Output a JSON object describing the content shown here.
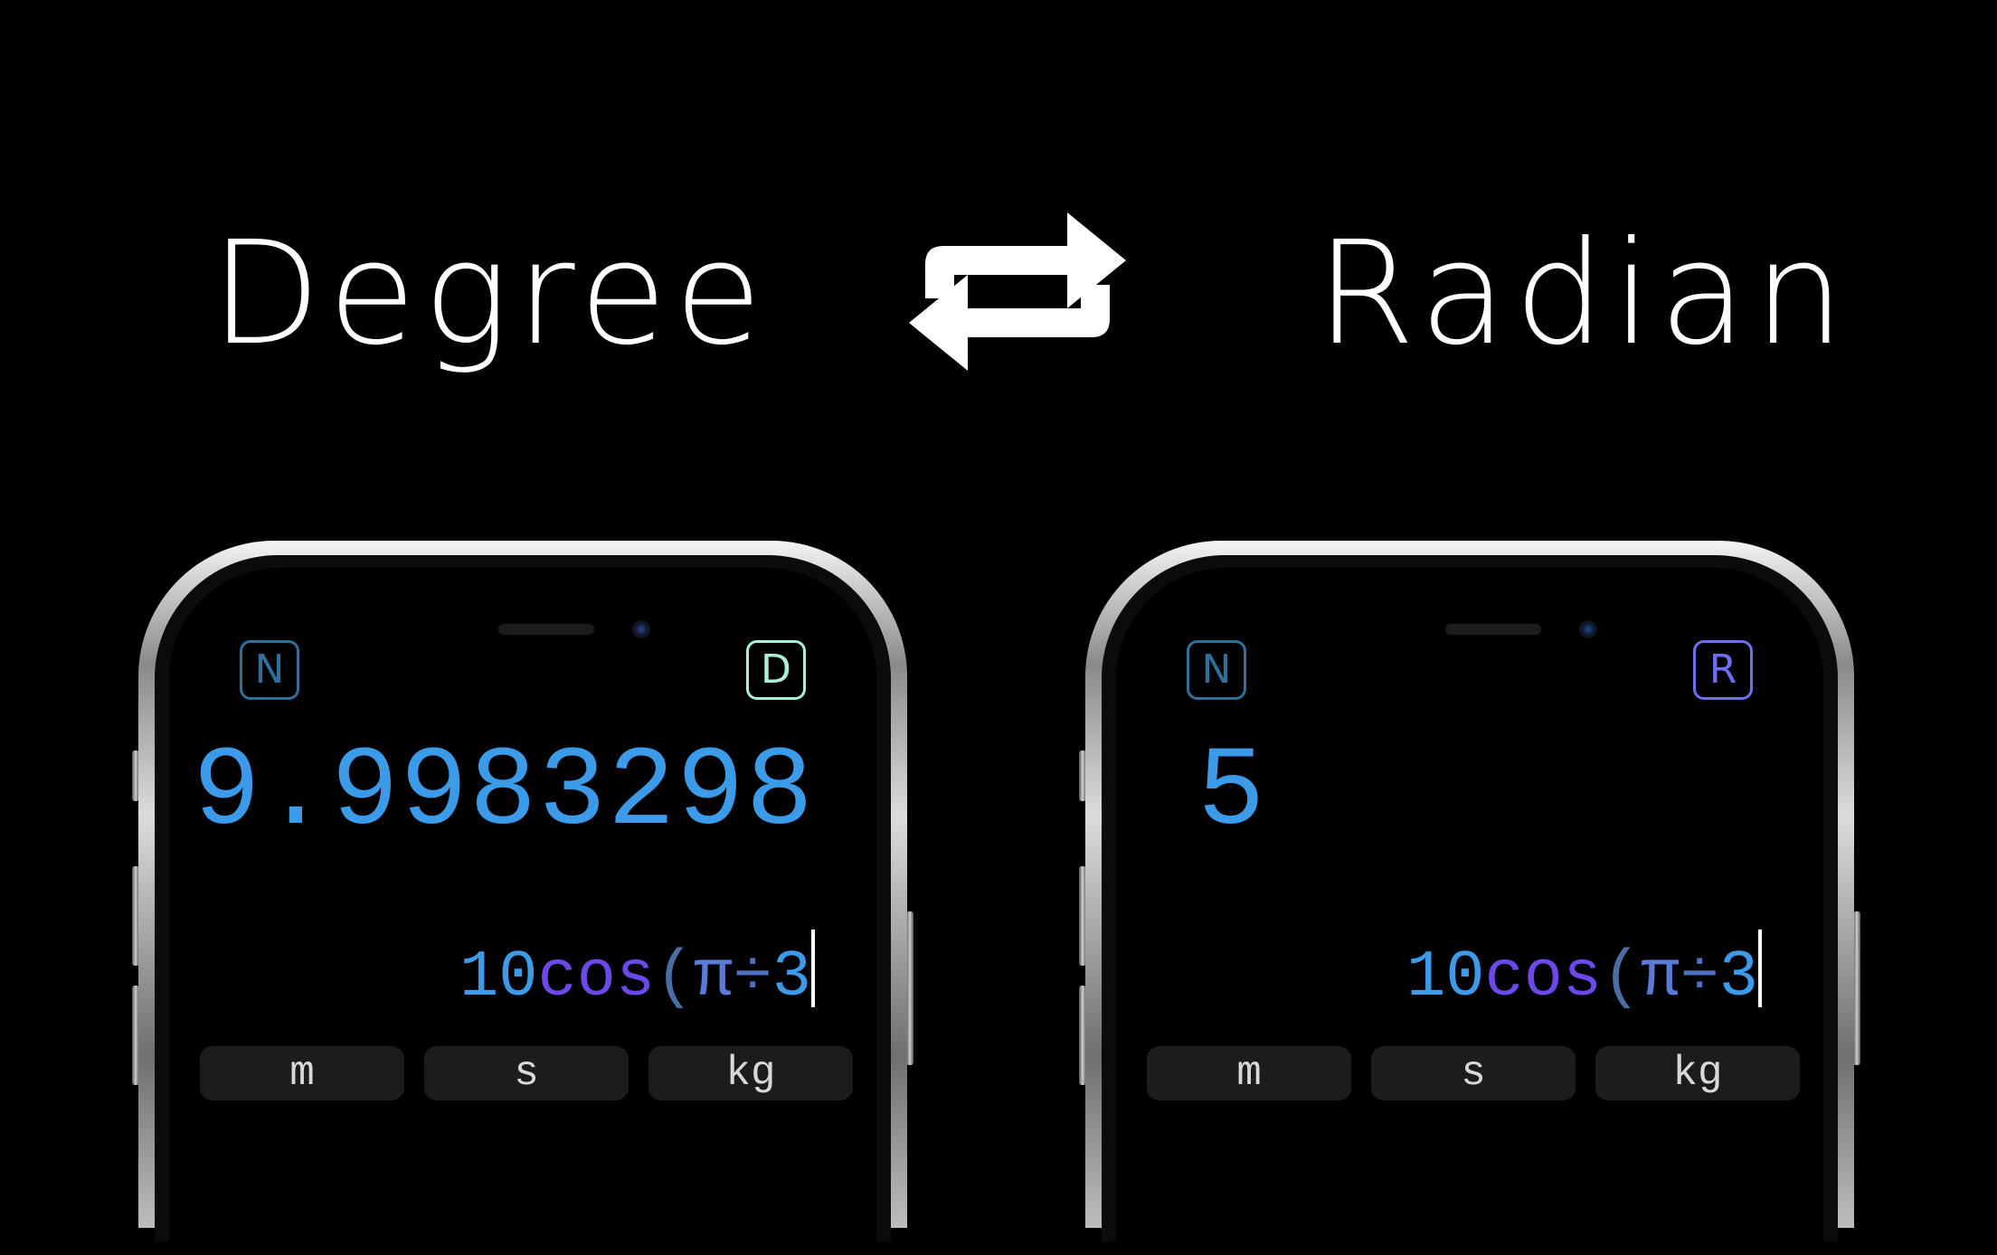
{
  "headlines": {
    "left": "Degree",
    "right": "Radian"
  },
  "swap_icon": "swap-arrows-icon",
  "phones": [
    {
      "mode_left": "N",
      "mode_right": "D",
      "mode_right_color": "#a8f0d8",
      "mode_left_color": "#2f6f9a",
      "result": "9.9983298",
      "expression": {
        "coef": "10",
        "fn": "cos",
        "open": "(",
        "pi": "π",
        "op": "÷",
        "arg": "3"
      },
      "units": [
        "m",
        "s",
        "kg"
      ]
    },
    {
      "mode_left": "N",
      "mode_right": "R",
      "mode_right_color": "#6b6ff0",
      "mode_left_color": "#2f6f9a",
      "result": "5",
      "expression": {
        "coef": "10",
        "fn": "cos",
        "open": "(",
        "pi": "π",
        "op": "÷",
        "arg": "3"
      },
      "units": [
        "m",
        "s",
        "kg"
      ]
    }
  ]
}
